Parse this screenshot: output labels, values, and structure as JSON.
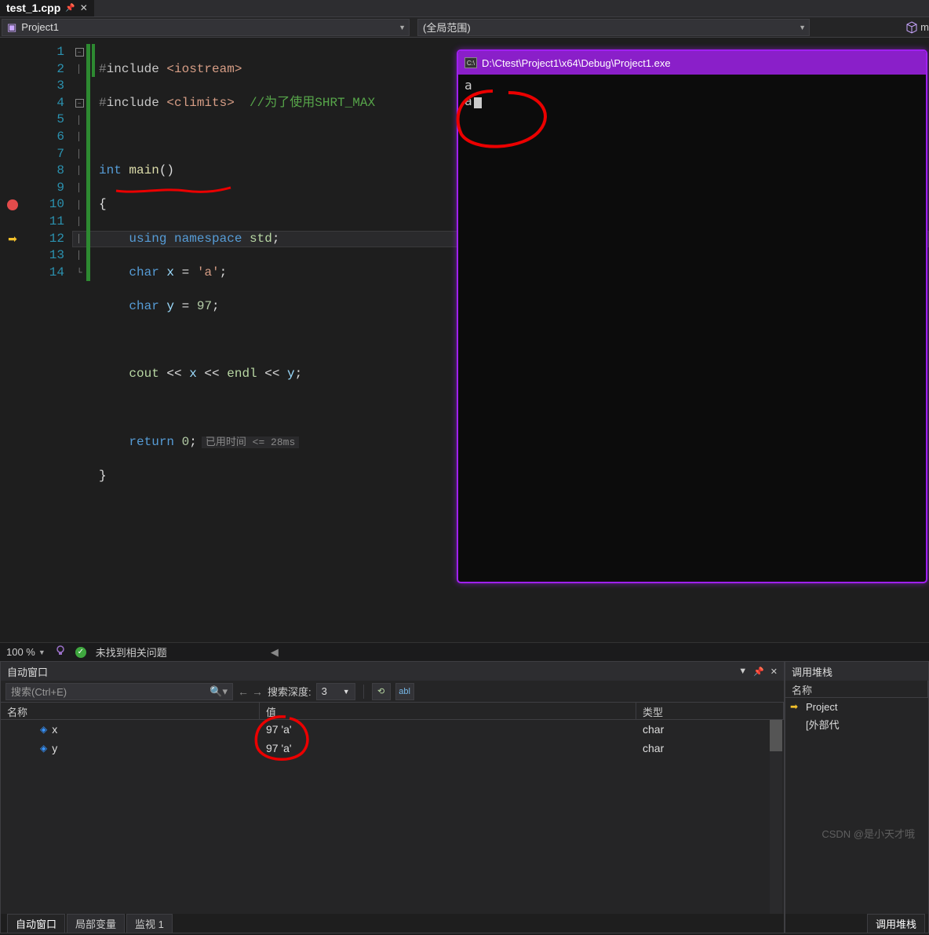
{
  "tab": {
    "name": "test_1.cpp"
  },
  "dropdowns": {
    "project": "Project1",
    "scope": "(全局范围)",
    "right": "m"
  },
  "code": {
    "lines": [
      1,
      2,
      3,
      4,
      5,
      6,
      7,
      8,
      9,
      10,
      11,
      12,
      13,
      14
    ],
    "breakpoint_line": 10,
    "current_line": 12,
    "l1_pre": "#",
    "l1_inc": "include ",
    "l1_hdr": "<iostream>",
    "l2_pre": "#",
    "l2_inc": "include ",
    "l2_hdr": "<climits>",
    "l2_cmt": "  //为了使用SHRT_MAX",
    "l4_kw1": "int ",
    "l4_fn": "main",
    "l4_par": "()",
    "l5": "{",
    "l6_kw": "using namespace ",
    "l6_ns": "std",
    "l6_sc": ";",
    "l7_kw": "char ",
    "l7_var": "x",
    "l7_eq": " = ",
    "l7_str": "'a'",
    "l7_sc": ";",
    "l8_kw": "char ",
    "l8_var": "y",
    "l8_eq": " = ",
    "l8_num": "97",
    "l8_sc": ";",
    "l10_ns": "cout",
    "l10_a": " << ",
    "l10_x": "x",
    "l10_b": " << ",
    "l10_endl": "endl",
    "l10_c": " << ",
    "l10_y": "y",
    "l10_sc": ";",
    "l12_kw": "return ",
    "l12_num": "0",
    "l12_sc": ";",
    "l12_perf": "已用时间 <= 28ms",
    "l13": "}"
  },
  "console": {
    "title": "D:\\Ctest\\Project1\\x64\\Debug\\Project1.exe",
    "line1": "a",
    "line2": "a"
  },
  "status": {
    "zoom": "100 %",
    "issues": "未找到相关问题"
  },
  "autos": {
    "title": "自动窗口",
    "search_placeholder": "搜索(Ctrl+E)",
    "depth_label": "搜索深度:",
    "depth_value": "3",
    "col_name": "名称",
    "col_val": "值",
    "col_type": "类型",
    "rows": [
      {
        "name": "x",
        "value": "97 'a'",
        "type": "char"
      },
      {
        "name": "y",
        "value": "97 'a'",
        "type": "char"
      }
    ]
  },
  "callstack": {
    "title": "调用堆栈",
    "col_name": "名称",
    "rows": [
      {
        "text": "Project",
        "current": true
      },
      {
        "text": "[外部代",
        "current": false
      }
    ],
    "bottom_tab": "调用堆栈"
  },
  "bottom_tabs": {
    "t1": "自动窗口",
    "t2": "局部变量",
    "t3": "监视 1"
  },
  "watermark": "CSDN @是小天才哦"
}
